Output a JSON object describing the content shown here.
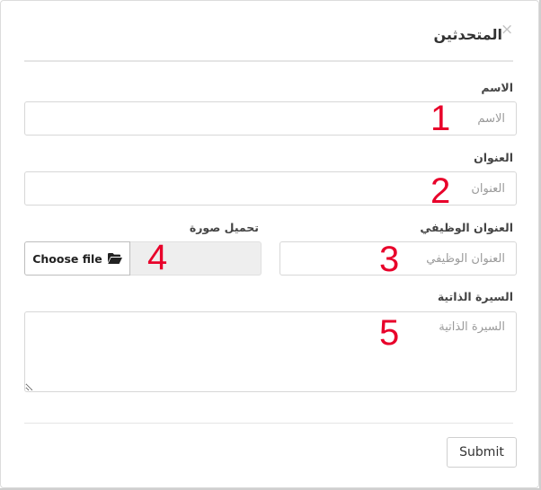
{
  "modal": {
    "title": "المتحدثين",
    "close_glyph": "×"
  },
  "form": {
    "name": {
      "label": "الاسم",
      "placeholder": "الاسم",
      "badge": "1"
    },
    "address": {
      "label": "العنوان",
      "placeholder": "العنوان",
      "badge": "2"
    },
    "job_title": {
      "label": "العنوان الوظيفي",
      "placeholder": "العنوان الوظيفي",
      "badge": "3"
    },
    "photo": {
      "label": "تحميل صورة",
      "button_label": "Choose file",
      "icon": "folder-open-icon",
      "badge": "4"
    },
    "bio": {
      "label": "السيرة الذاتية",
      "placeholder": "السيرة الذاتية",
      "badge": "5"
    }
  },
  "footer": {
    "submit_label": "Submit"
  },
  "colors": {
    "badge": "#e8002a",
    "file_name_bg": "#eeeeee"
  }
}
